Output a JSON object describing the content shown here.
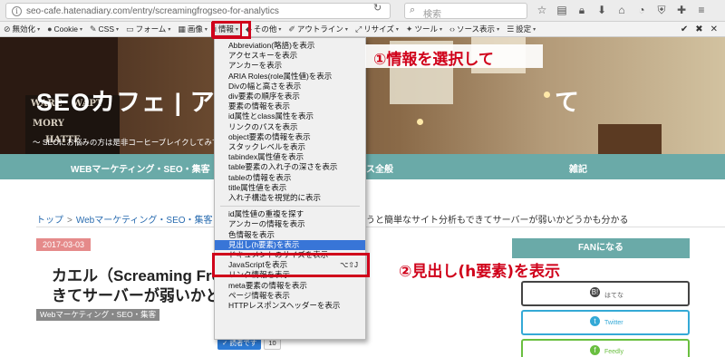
{
  "browser": {
    "url": "seo-cafe.hatenadiary.com/entry/screamingfrogseo-for-analytics",
    "search_placeholder": "検索",
    "nav_icons": [
      "star-icon",
      "reading-list-icon",
      "lock-icon",
      "download-icon",
      "home-icon",
      "chat-icon",
      "shield-icon",
      "extension-icon",
      "menu-icon"
    ]
  },
  "devbar": {
    "items": [
      {
        "icon": "⊘",
        "label": "無効化"
      },
      {
        "icon": "●",
        "label": "Cookie"
      },
      {
        "icon": "✎",
        "label": "CSS"
      },
      {
        "icon": "▭",
        "label": "フォーム"
      },
      {
        "icon": "▦",
        "label": "画像"
      },
      {
        "icon": "i",
        "label": "情報"
      },
      {
        "icon": "◆",
        "label": "その他"
      },
      {
        "icon": "✐",
        "label": "アウトライン"
      },
      {
        "icon": "⤢",
        "label": "リサイズ"
      },
      {
        "icon": "✦",
        "label": "ツール"
      },
      {
        "icon": "‹›",
        "label": "ソース表示"
      },
      {
        "icon": "☰",
        "label": "設定"
      }
    ],
    "active_index": 5,
    "right_icons": [
      "✔",
      "✖",
      "✕"
    ]
  },
  "site": {
    "title": "SEOカフェ | ア",
    "title_tail": "て",
    "subtitle": "～ SEOにお悩みの方は是非コーヒーブレイクしてみて",
    "chalk_lines": [
      "WARE",
      "WAPT",
      "MORY",
      "HATTE"
    ],
    "nav": [
      "WEBマーケティング・SEO・集客",
      "ス全般",
      "雑記"
    ]
  },
  "breadcrumb": {
    "home": "トップ",
    "sep": ">",
    "category": "Webマーケティング・SEO・集客",
    "tail": "うと簡単なサイト分析もできてサーバーが弱いかどうかも分かる"
  },
  "article": {
    "date": "2017-03-03",
    "title_line1": "カエル（Screaming Frog",
    "title_line2": "きてサーバーが弱いかど",
    "category": "Webマーケティング・SEO・集客",
    "share_label": "✓ 読者です",
    "share_count": "10"
  },
  "sidebar": {
    "heading": "FANになる",
    "buttons": [
      {
        "icon": "B!",
        "label": "はてな"
      },
      {
        "icon": "t",
        "label": "Twitter"
      },
      {
        "icon": "f",
        "label": "Feedly"
      }
    ]
  },
  "menu": {
    "group1": [
      "Abbreviation(略語)を表示",
      "アクセスキーを表示",
      "アンカーを表示",
      "ARIA Roles(role属性値)を表示",
      "Divの幅と高さを表示",
      "div要素の順序を表示",
      "要素の情報を表示",
      "id属性とclass属性を表示",
      "リンクのパスを表示",
      "object要素の情報を表示",
      "スタックレベルを表示",
      "tabindex属性値を表示",
      "table要素の入れ子の深さを表示",
      "tableの情報を表示",
      "title属性値を表示",
      "入れ子構造を視覚的に表示"
    ],
    "group2": [
      {
        "label": "id属性値の重複を探す",
        "shortcut": ""
      },
      {
        "label": "アンカーの情報を表示",
        "shortcut": ""
      },
      {
        "label": "色情報を表示",
        "shortcut": ""
      },
      {
        "label": "見出し(h要素)を表示",
        "shortcut": ""
      },
      {
        "label": "ドキュメントのサイズを表示",
        "shortcut": ""
      },
      {
        "label": "JavaScriptを表示",
        "shortcut": "⌥⇧J"
      },
      {
        "label": "リンク情報を表示",
        "shortcut": ""
      },
      {
        "label": "meta要素の情報を表示",
        "shortcut": ""
      },
      {
        "label": "ページ情報を表示",
        "shortcut": ""
      },
      {
        "label": "HTTPレスポンスヘッダーを表示",
        "shortcut": ""
      }
    ],
    "highlighted_item": "見出し(h要素)を表示"
  },
  "annotations": {
    "step1": "①情報を選択して",
    "step2": "②見出し(h要素)を表示",
    "color": "#d0021b"
  }
}
